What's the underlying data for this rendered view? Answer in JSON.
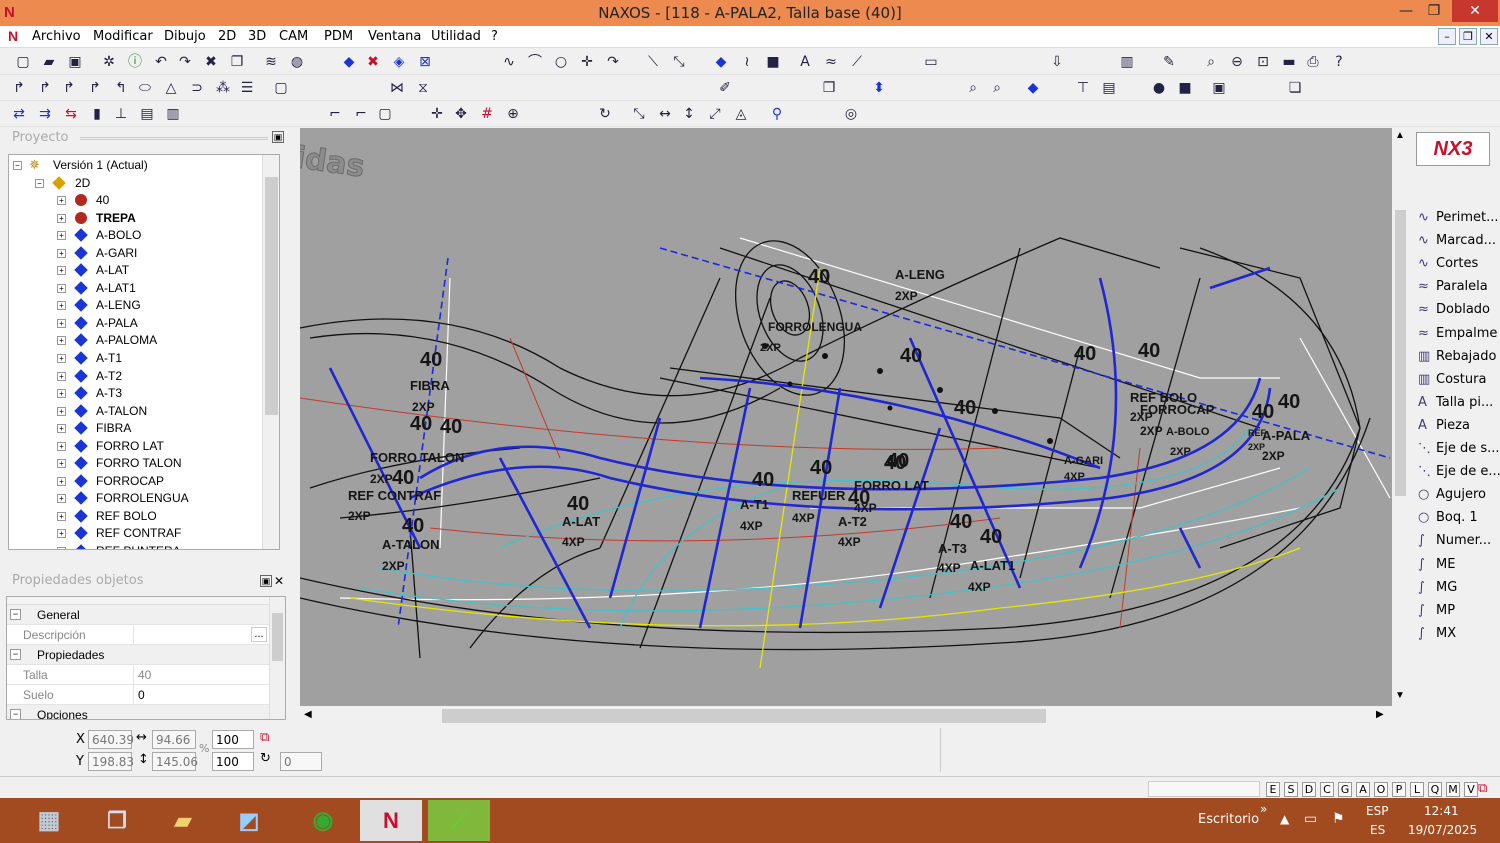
{
  "window": {
    "title": "NAXOS - [118 - A-PALA2, Talla base (40)]",
    "min": "—",
    "max": "❐",
    "close": "✕"
  },
  "menu": [
    "Archivo",
    "Modificar",
    "Dibujo",
    "2D",
    "3D",
    "CAM",
    "PDM",
    "Ventana",
    "Utilidad",
    "?"
  ],
  "project_panel": {
    "title": "Proyecto"
  },
  "tree": {
    "root": "Versión 1 (Actual)",
    "node": "2D",
    "items": [
      "40",
      "TREPA",
      "A-BOLO",
      "A-GARI",
      "A-LAT",
      "A-LAT1",
      "A-LENG",
      "A-PALA",
      "A-PALOMA",
      "A-T1",
      "A-T2",
      "A-T3",
      "A-TALON",
      "FIBRA",
      "FORRO LAT",
      "FORRO TALON",
      "FORROCAP",
      "FORROLENGUA",
      "REF BOLO",
      "REF CONTRAF",
      "REF PUNTERA"
    ]
  },
  "props_panel": {
    "title": "Propiedades objetos",
    "sections": {
      "general": "General",
      "props": "Propiedades",
      "options": "Opciones"
    },
    "fields": {
      "descripcion": {
        "label": "Descripción",
        "value": ""
      },
      "talla": {
        "label": "Talla",
        "value": "40"
      },
      "suelo": {
        "label": "Suelo",
        "value": "0"
      }
    },
    "ellipsis": "..."
  },
  "canvas": {
    "watermark": "idas",
    "labels": [
      {
        "t": "40"
      },
      {
        "t": "A-LENG"
      },
      {
        "t": "2XP"
      },
      {
        "t": "FORROLENGUA"
      },
      {
        "t": "2XP"
      },
      {
        "t": "40"
      },
      {
        "t": "40"
      },
      {
        "t": "40"
      },
      {
        "t": "40"
      },
      {
        "t": "40"
      },
      {
        "t": "REF BOLO"
      },
      {
        "t": "FORROCAP"
      },
      {
        "t": "2XP"
      },
      {
        "t": "2XP"
      },
      {
        "t": "A-BOLO"
      },
      {
        "t": "2XP"
      },
      {
        "t": "40"
      },
      {
        "t": "40"
      },
      {
        "t": "A-PALA"
      },
      {
        "t": "2XP"
      },
      {
        "t": "REF"
      },
      {
        "t": "2XP"
      },
      {
        "t": "40"
      },
      {
        "t": "FIBRA"
      },
      {
        "t": "2XP"
      },
      {
        "t": "40"
      },
      {
        "t": "40"
      },
      {
        "t": "FORRO TALON"
      },
      {
        "t": "2XP"
      },
      {
        "t": "40"
      },
      {
        "t": "REF CONTRAF"
      },
      {
        "t": "2XP"
      },
      {
        "t": "40"
      },
      {
        "t": "A-TALON"
      },
      {
        "t": "2XP"
      },
      {
        "t": "40"
      },
      {
        "t": "A-LAT"
      },
      {
        "t": "4XP"
      },
      {
        "t": "40"
      },
      {
        "t": "A-T1"
      },
      {
        "t": "4XP"
      },
      {
        "t": "40"
      },
      {
        "t": "REFUER"
      },
      {
        "t": "40"
      },
      {
        "t": "FORRO LAT"
      },
      {
        "t": "4XP"
      },
      {
        "t": "4XP"
      },
      {
        "t": "A-T2"
      },
      {
        "t": "4XP"
      },
      {
        "t": "40"
      },
      {
        "t": "40"
      },
      {
        "t": "40"
      },
      {
        "t": "A-T3"
      },
      {
        "t": "4XP"
      },
      {
        "t": "A-LAT1"
      },
      {
        "t": "4XP"
      },
      {
        "t": "A-GARI"
      },
      {
        "t": "4XP"
      }
    ]
  },
  "right_panel": {
    "logo": "NX3",
    "items": [
      {
        "label": "Perimet...",
        "icon": "perimeter-icon",
        "glyph": "∿"
      },
      {
        "label": "Marcad...",
        "icon": "marker-icon",
        "glyph": "∿"
      },
      {
        "label": "Cortes",
        "icon": "cuts-icon",
        "glyph": "∿"
      },
      {
        "label": "Paralela",
        "icon": "parallel-icon",
        "glyph": "≈"
      },
      {
        "label": "Doblado",
        "icon": "fold-icon",
        "glyph": "≈"
      },
      {
        "label": "Empalme",
        "icon": "splice-icon",
        "glyph": "≈"
      },
      {
        "label": "Rebajado",
        "icon": "skive-icon",
        "glyph": "▥"
      },
      {
        "label": "Costura",
        "icon": "seam-icon",
        "glyph": "▥"
      },
      {
        "label": "Talla pi...",
        "icon": "size-text-icon",
        "glyph": "A"
      },
      {
        "label": "Pieza",
        "icon": "piece-text-icon",
        "glyph": "A"
      },
      {
        "label": "Eje de s...",
        "icon": "axis-icon",
        "glyph": "⋱"
      },
      {
        "label": "Eje de e...",
        "icon": "axis2-icon",
        "glyph": "⋱"
      },
      {
        "label": "Agujero",
        "icon": "hole-icon",
        "glyph": "○"
      },
      {
        "label": "Boq. 1",
        "icon": "punch-icon",
        "glyph": "○"
      },
      {
        "label": "Numer...",
        "icon": "number-icon",
        "glyph": "∫"
      },
      {
        "label": "ME",
        "icon": "me-icon",
        "glyph": "∫"
      },
      {
        "label": "MG",
        "icon": "mg-icon",
        "glyph": "∫"
      },
      {
        "label": "MP",
        "icon": "mp-icon",
        "glyph": "∫"
      },
      {
        "label": "MX",
        "icon": "mx-icon",
        "glyph": "∫"
      }
    ]
  },
  "coords": {
    "x_label": "X",
    "y_label": "Y",
    "x": "640.39",
    "y": "198.83",
    "w": "94.66",
    "h": "145.06",
    "sx": "100",
    "sy": "100",
    "angle": "0",
    "pct": "%"
  },
  "status_keys": [
    "E",
    "S",
    "D",
    "C",
    "G",
    "A",
    "O",
    "P",
    "L",
    "Q",
    "M",
    "V"
  ],
  "taskbar": {
    "desktop": "Escritorio",
    "lang1": "ESP",
    "lang2": "ES",
    "time": "12:41",
    "date": "19/07/2025",
    "chev": "»"
  },
  "colors": {
    "titlebar": "#ec8a50",
    "canvas": "#a0a0a0",
    "taskbar": "#a34b20",
    "accent_blue": "#1a35d6"
  }
}
